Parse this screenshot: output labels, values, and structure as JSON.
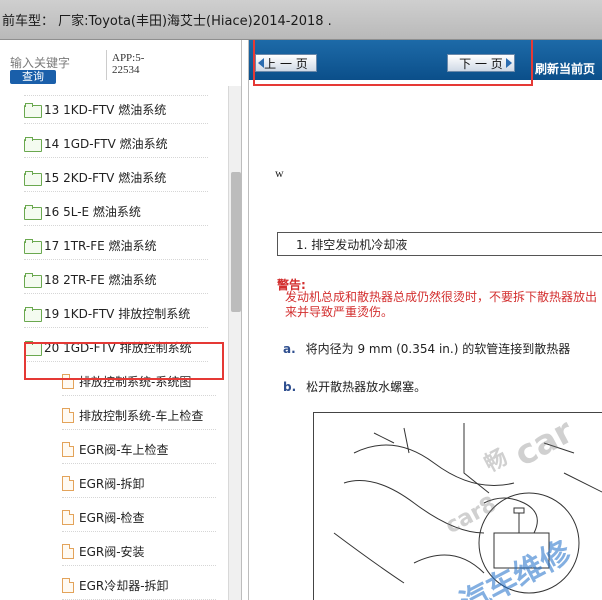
{
  "window": {
    "title": "前车型：  厂家:Toyota(丰田)海艾士(Hiace)2014-2018   ."
  },
  "left_panel": {
    "search_placeholder": "输入关键字",
    "search_button": "查询",
    "app_code_line1": "APP:5-",
    "app_code_line2": "22534",
    "tree": [
      {
        "label": "13 1KD-FTV 燃油系统",
        "type": "folder"
      },
      {
        "label": "14 1GD-FTV 燃油系统",
        "type": "folder"
      },
      {
        "label": "15 2KD-FTV 燃油系统",
        "type": "folder"
      },
      {
        "label": "16 5L-E 燃油系统",
        "type": "folder"
      },
      {
        "label": "17 1TR-FE 燃油系统",
        "type": "folder"
      },
      {
        "label": "18 2TR-FE 燃油系统",
        "type": "folder"
      },
      {
        "label": "19 1KD-FTV 排放控制系统",
        "type": "folder"
      },
      {
        "label": "20 1GD-FTV 排放控制系统",
        "type": "folder-open",
        "selected": true
      },
      {
        "label": "排放控制系统-系统图",
        "type": "page"
      },
      {
        "label": "排放控制系统-车上检查",
        "type": "page"
      },
      {
        "label": "EGR阀-车上检查",
        "type": "page"
      },
      {
        "label": "EGR阀-拆卸",
        "type": "page"
      },
      {
        "label": "EGR阀-检查",
        "type": "page"
      },
      {
        "label": "EGR阀-安装",
        "type": "page"
      },
      {
        "label": "EGR冷却器-拆卸",
        "type": "page"
      }
    ]
  },
  "toolbar": {
    "prev_label": "上 一 页",
    "next_label": "下 一 页",
    "refresh_label": "刷新当前页"
  },
  "document": {
    "mark": "w",
    "step_title": "1. 排空发动机冷却液",
    "warning_title": "警告:",
    "warning_text": "发动机总成和散热器总成仍然很烫时，不要拆下散热器放出来并导致严重烫伤。",
    "step_a_label": "a.",
    "step_a_text": "将内径为 9 mm (0.354 in.) 的软管连接到散热器",
    "step_b_label": "b.",
    "step_b_text": "松开散热器放水螺塞。"
  },
  "watermark": {
    "text_cn": "畅",
    "text_a": "car",
    "text_b": "car8",
    "text_c": "汽车维修"
  },
  "colors": {
    "toolbar_blue": "#0b4f8a",
    "warning_red": "#d32f2f",
    "highlight_red": "#e53935",
    "search_button_blue": "#1a5faa"
  }
}
